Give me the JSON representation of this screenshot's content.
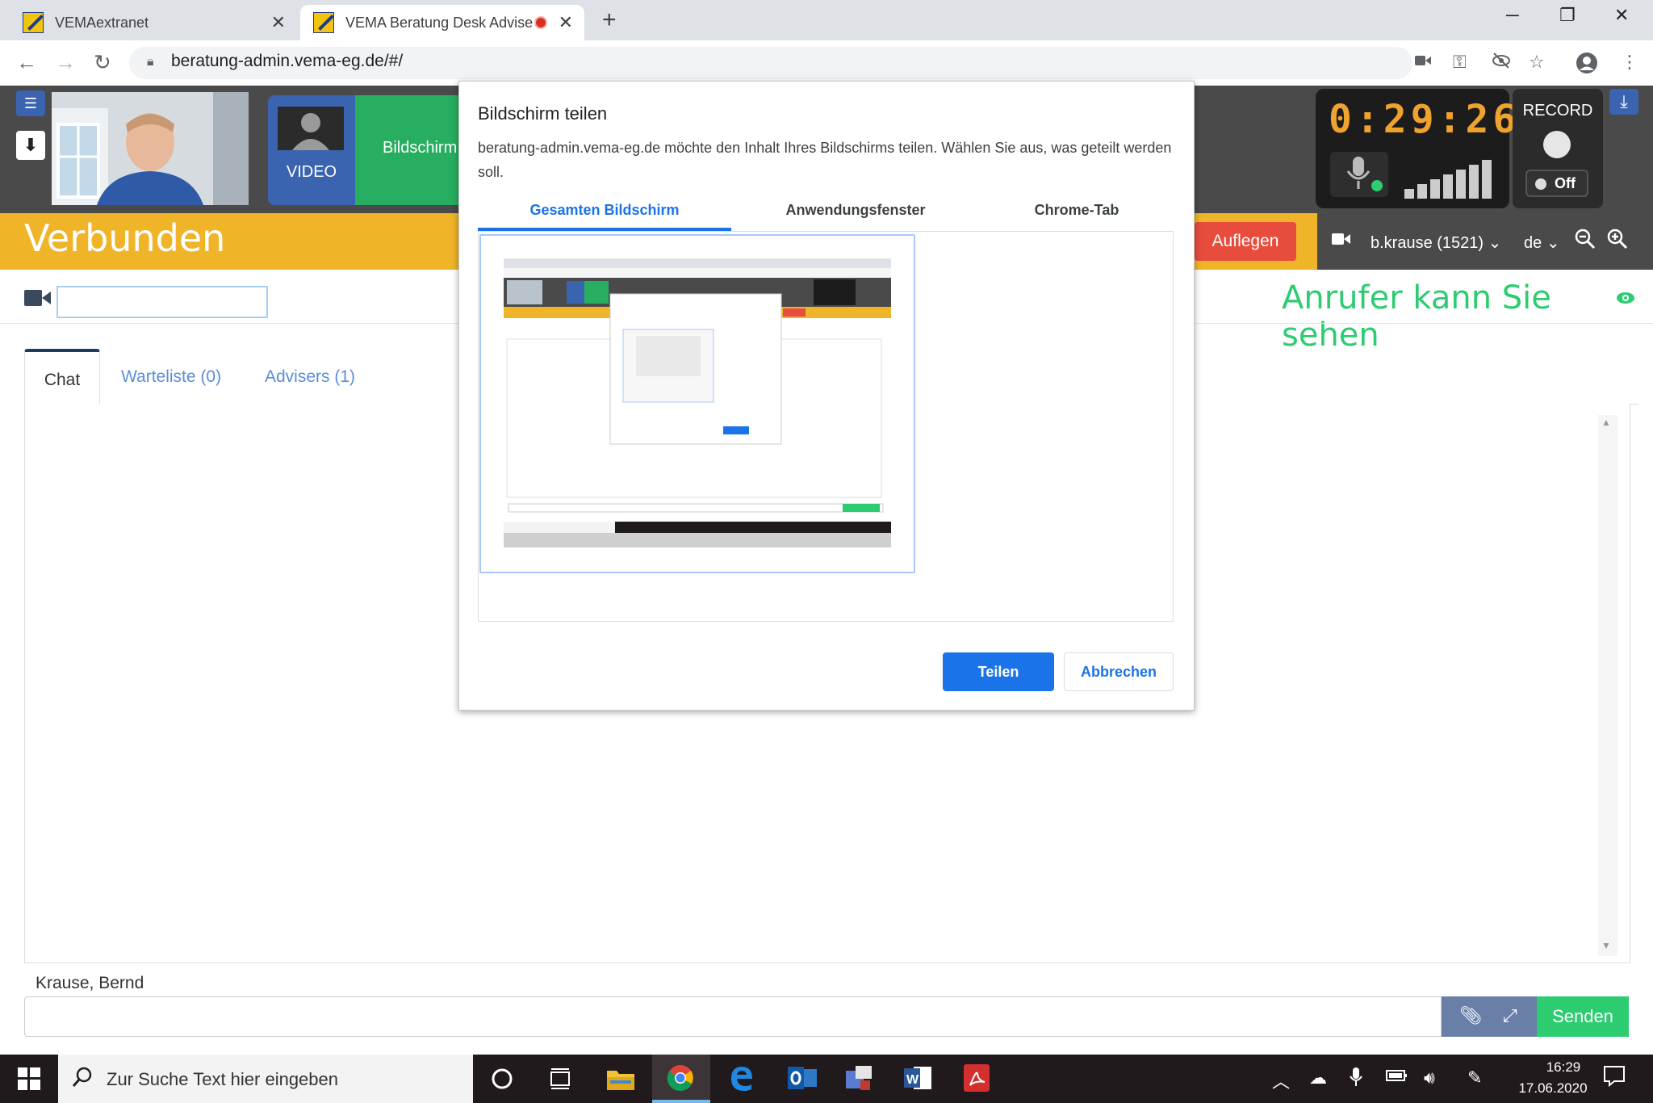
{
  "browser": {
    "tabs": [
      {
        "title": "VEMAextranet"
      },
      {
        "title": "VEMA Beratung Desk Advise"
      }
    ],
    "url": "beratung-admin.vema-eg.de/#/"
  },
  "header": {
    "video_label": "VIDEO",
    "screen_label": "Bildschirm",
    "timer": "0:29:26",
    "record_label": "RECORD",
    "record_toggle": "Off"
  },
  "statusbar": {
    "status": "Verbunden",
    "hangup_label": "Auflegen",
    "user": "b.krause (1521)",
    "language": "de"
  },
  "main": {
    "visibility_text": "Anrufer kann Sie sehen",
    "tabs": [
      {
        "label": "Chat"
      },
      {
        "label": "Warteliste (0)"
      },
      {
        "label": "Advisers (1)"
      }
    ],
    "author": "Krause, Bernd",
    "send_label": "Senden"
  },
  "dialog": {
    "title": "Bildschirm teilen",
    "message": "beratung-admin.vema-eg.de möchte den Inhalt Ihres Bildschirms teilen. Wählen Sie aus, was geteilt werden soll.",
    "tabs": [
      {
        "label": "Gesamten Bildschirm"
      },
      {
        "label": "Anwendungsfenster"
      },
      {
        "label": "Chrome-Tab"
      }
    ],
    "share_label": "Teilen",
    "cancel_label": "Abbrechen"
  },
  "taskbar": {
    "search_placeholder": "Zur Suche Text hier eingeben",
    "time": "16:29",
    "date": "17.06.2020"
  },
  "colors": {
    "status_yellow": "#f0b429",
    "header_dark": "#4a4a4a",
    "accent_blue": "#1a73e8",
    "green": "#2ecc71",
    "hangup_red": "#e74c3c",
    "timer_orange": "#f0a22e"
  }
}
